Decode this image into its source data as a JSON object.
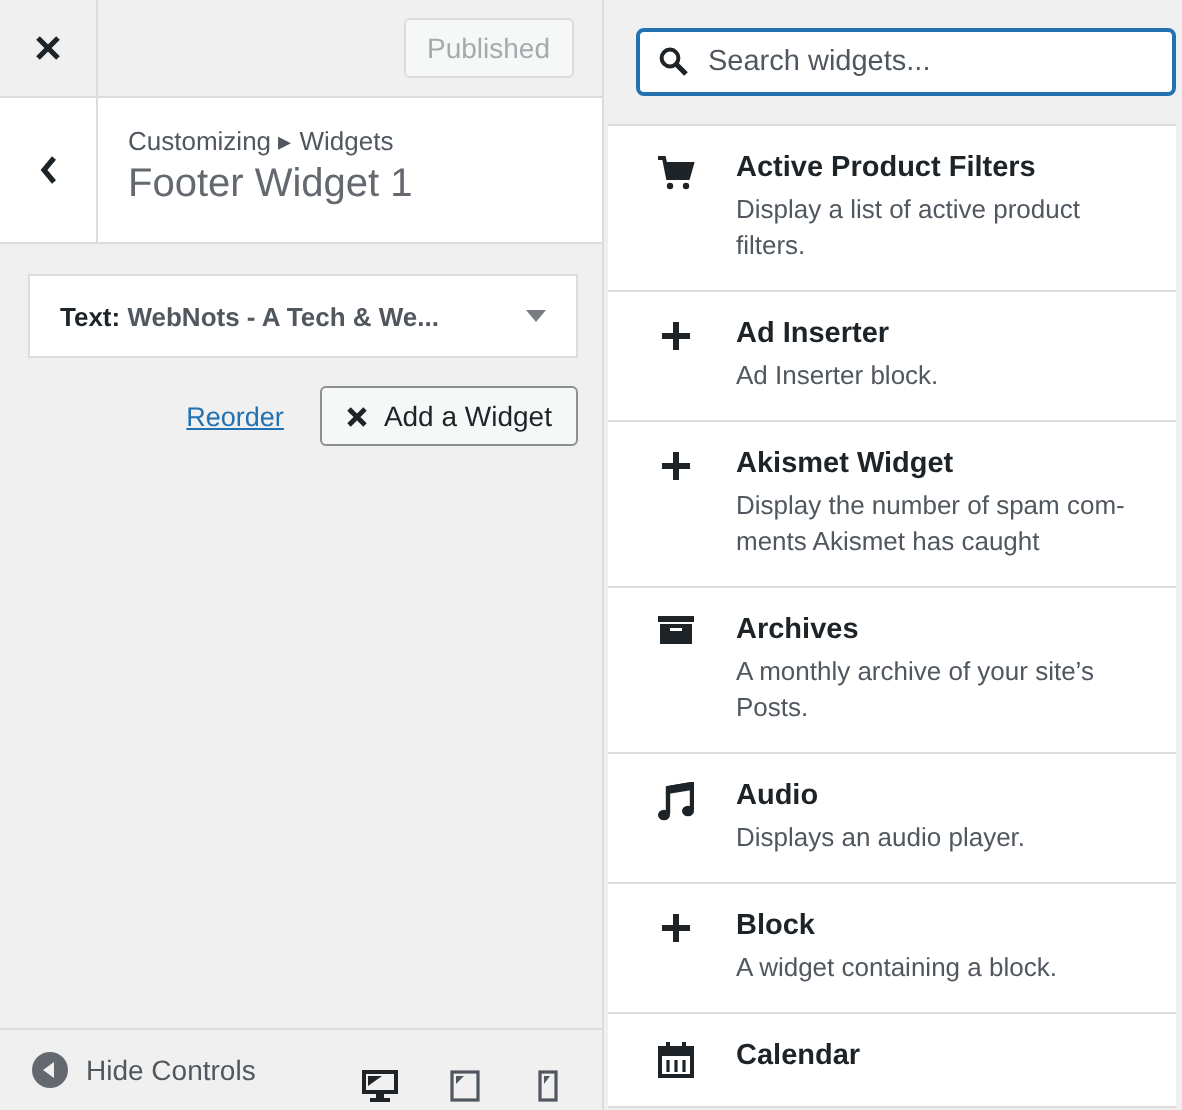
{
  "top_bar": {
    "publish_button": {
      "label": "Published",
      "disabled": true
    }
  },
  "header": {
    "breadcrumb": "Customizing ▸ Widgets",
    "title": "Footer Widget 1"
  },
  "widget": {
    "type": "Text:",
    "name": "WebNots - A Tech & We..."
  },
  "actions": {
    "reorder": "Reorder",
    "add": "Add a Widget"
  },
  "footer": {
    "hide_controls": "Hide Controls",
    "devices": [
      {
        "kind": "desktop",
        "selected": true
      },
      {
        "kind": "tablet",
        "selected": false
      },
      {
        "kind": "mobile",
        "selected": false
      }
    ]
  },
  "search": {
    "placeholder": "Search widgets..."
  },
  "widgets": [
    {
      "kind": "cart",
      "title": "Active Product Filters",
      "description": "Display a list of active product filters."
    },
    {
      "kind": "plus",
      "title": "Ad Inserter",
      "description": "Ad Inserter block."
    },
    {
      "kind": "plus",
      "title": "Akismet Widget",
      "description": "Display the number of spam com-ments Akismet has caught"
    },
    {
      "kind": "archive",
      "title": "Archives",
      "description": "A monthly archive of your site’s Posts."
    },
    {
      "kind": "music",
      "title": "Audio",
      "description": "Displays an audio player."
    },
    {
      "kind": "plus",
      "title": "Block",
      "description": "A widget containing a block."
    },
    {
      "kind": "calendar",
      "title": "Calendar"
    }
  ]
}
